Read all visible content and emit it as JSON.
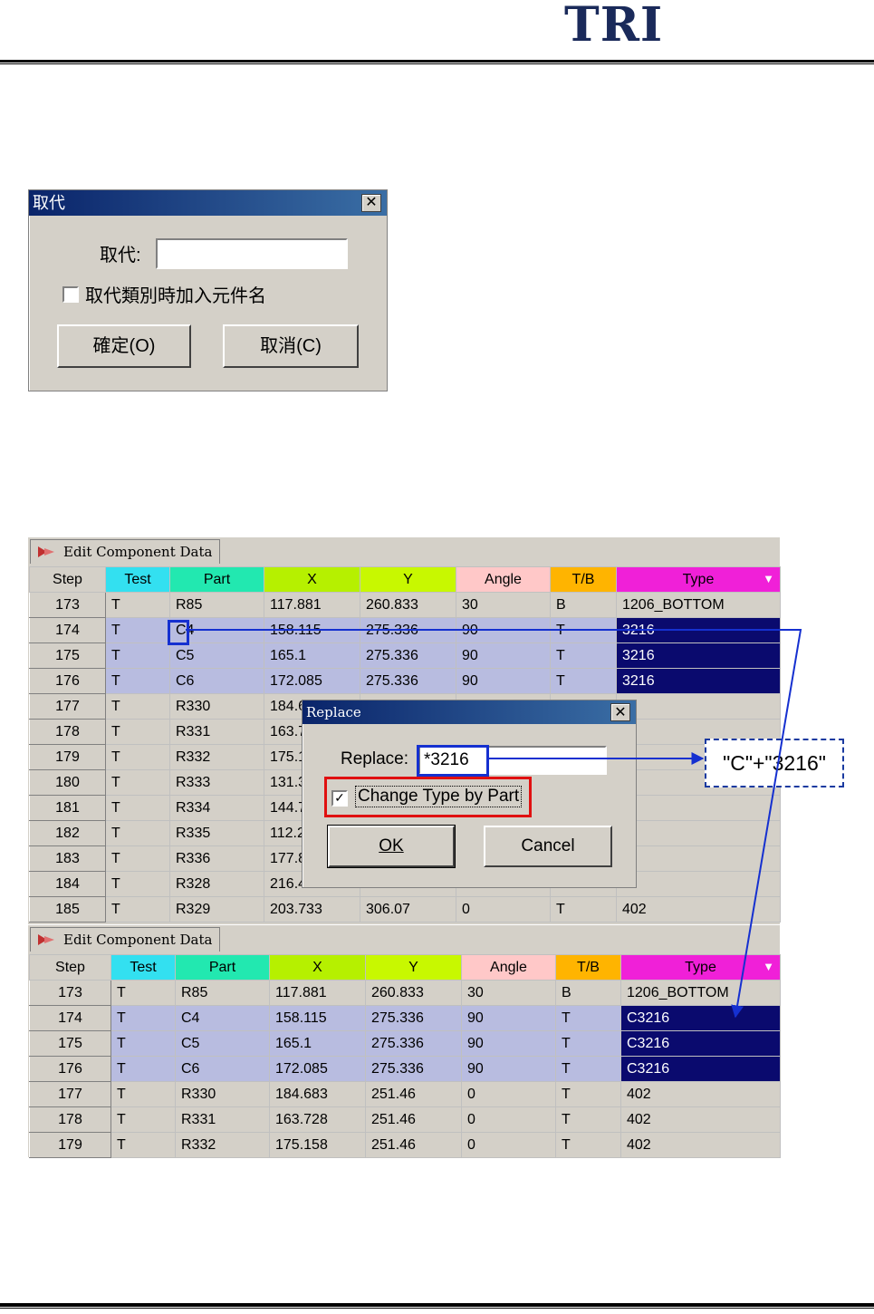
{
  "header": {
    "logo_text": "TRI"
  },
  "zh_dialog": {
    "title": "取代",
    "replace_label": "取代:",
    "replace_value": "",
    "checkbox_label": "取代類別時加入元件名",
    "checkbox_checked": false,
    "ok_label": "確定(O)",
    "cancel_label": "取消(C)"
  },
  "grid_before": {
    "tab_label": "Edit Component Data",
    "columns": [
      "Step",
      "Test",
      "Part",
      "X",
      "Y",
      "Angle",
      "T/B",
      "Type"
    ],
    "rows": [
      [
        "173",
        "T",
        "R85",
        "117.881",
        "260.833",
        "30",
        "B",
        "1206_BOTTOM"
      ],
      [
        "174",
        "T",
        "C4",
        "158.115",
        "275.336",
        "90",
        "T",
        "3216"
      ],
      [
        "175",
        "T",
        "C5",
        "165.1",
        "275.336",
        "90",
        "T",
        "3216"
      ],
      [
        "176",
        "T",
        "C6",
        "172.085",
        "275.336",
        "90",
        "T",
        "3216"
      ],
      [
        "177",
        "T",
        "R330",
        "184.6",
        "",
        "",
        "",
        "2"
      ],
      [
        "178",
        "T",
        "R331",
        "163.7",
        "",
        "",
        "",
        "2"
      ],
      [
        "179",
        "T",
        "R332",
        "175.1",
        "",
        "",
        "",
        "2"
      ],
      [
        "180",
        "T",
        "R333",
        "131.3",
        "",
        "",
        "",
        "2"
      ],
      [
        "181",
        "T",
        "R334",
        "144.7",
        "",
        "",
        "",
        "2"
      ],
      [
        "182",
        "T",
        "R335",
        "112.2",
        "",
        "",
        "",
        "2"
      ],
      [
        "183",
        "T",
        "R336",
        "177.8",
        "",
        "",
        "",
        "2"
      ],
      [
        "184",
        "T",
        "R328",
        "216.4",
        "",
        "",
        "",
        "2"
      ],
      [
        "185",
        "T",
        "R329",
        "203.733",
        "306.07",
        "0",
        "T",
        "402"
      ]
    ]
  },
  "replace_dialog": {
    "title": "Replace",
    "replace_label": "Replace:",
    "replace_value": "*3216",
    "checkbox_label": "Change Type by Part",
    "checkbox_checked": true,
    "ok_label": "OK",
    "cancel_label": "Cancel"
  },
  "note": {
    "text": "\"C\"+\"3216\""
  },
  "grid_after": {
    "tab_label": "Edit Component Data",
    "columns": [
      "Step",
      "Test",
      "Part",
      "X",
      "Y",
      "Angle",
      "T/B",
      "Type"
    ],
    "rows": [
      [
        "173",
        "T",
        "R85",
        "117.881",
        "260.833",
        "30",
        "B",
        "1206_BOTTOM"
      ],
      [
        "174",
        "T",
        "C4",
        "158.115",
        "275.336",
        "90",
        "T",
        "C3216"
      ],
      [
        "175",
        "T",
        "C5",
        "165.1",
        "275.336",
        "90",
        "T",
        "C3216"
      ],
      [
        "176",
        "T",
        "C6",
        "172.085",
        "275.336",
        "90",
        "T",
        "C3216"
      ],
      [
        "177",
        "T",
        "R330",
        "184.683",
        "251.46",
        "0",
        "T",
        "402"
      ],
      [
        "178",
        "T",
        "R331",
        "163.728",
        "251.46",
        "0",
        "T",
        "402"
      ],
      [
        "179",
        "T",
        "R332",
        "175.158",
        "251.46",
        "0",
        "T",
        "402"
      ]
    ]
  },
  "colors": {
    "selection_type_bg": "#0a0a6e",
    "annotation_blue": "#1530d0",
    "annotation_red": "#e01010"
  }
}
